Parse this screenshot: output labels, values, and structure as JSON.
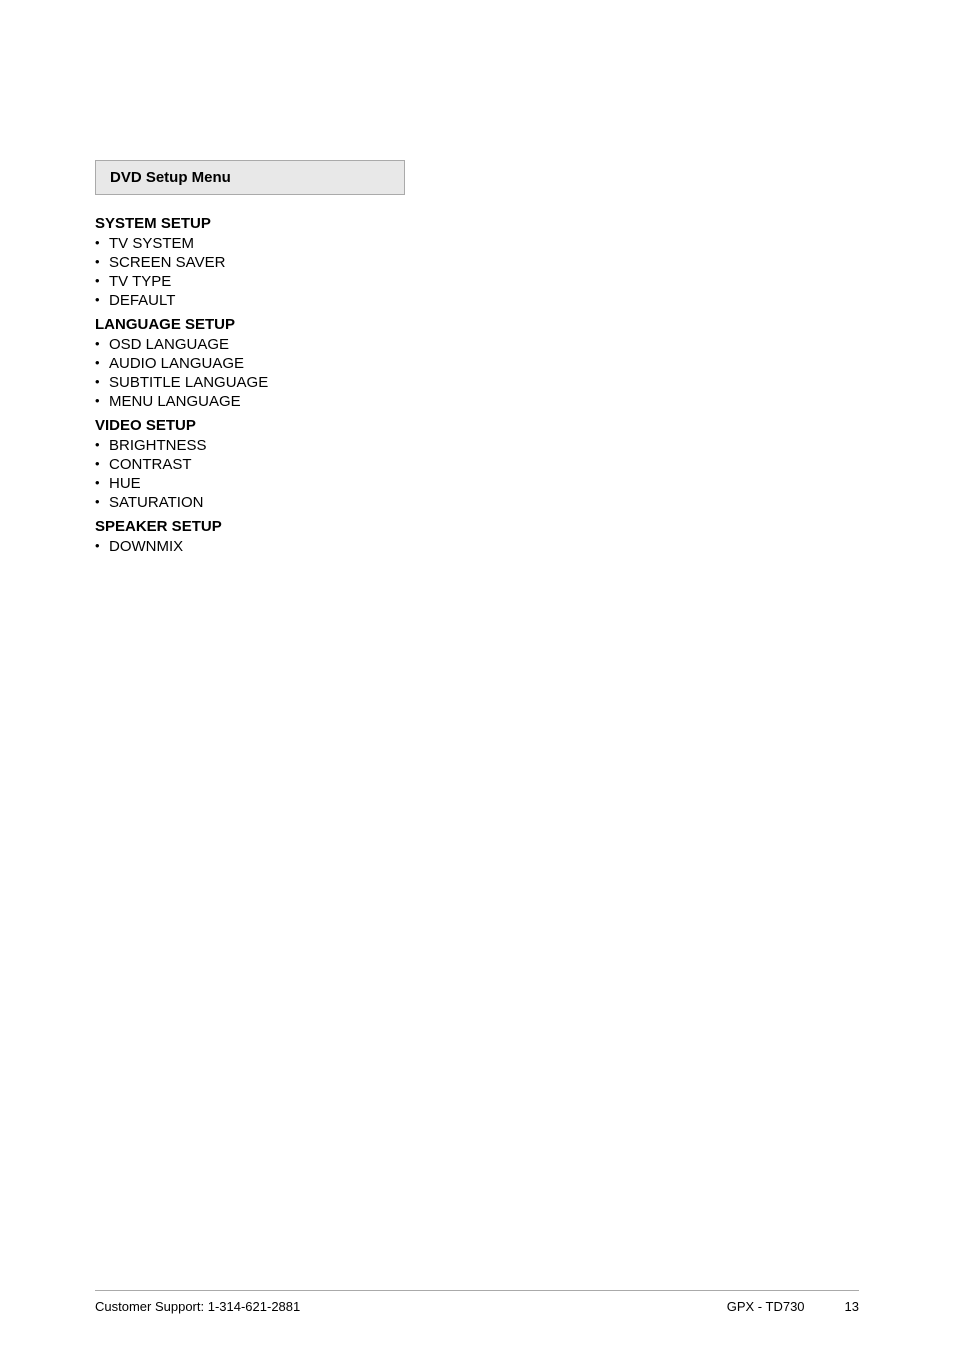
{
  "menuBox": {
    "title": "DVD Setup Menu"
  },
  "sections": [
    {
      "id": "system-setup",
      "title": "SYSTEM SETUP",
      "items": [
        "TV SYSTEM",
        "SCREEN SAVER",
        "TV TYPE",
        "DEFAULT"
      ]
    },
    {
      "id": "language-setup",
      "title": "LANGUAGE SETUP",
      "items": [
        "OSD LANGUAGE",
        "AUDIO LANGUAGE",
        "SUBTITLE LANGUAGE",
        "MENU LANGUAGE"
      ]
    },
    {
      "id": "video-setup",
      "title": "VIDEO SETUP",
      "items": [
        "BRIGHTNESS",
        "CONTRAST",
        "HUE",
        "SATURATION"
      ]
    },
    {
      "id": "speaker-setup",
      "title": "SPEAKER SETUP",
      "items": [
        "DOWNMIX"
      ]
    }
  ],
  "footer": {
    "support": "Customer Support: 1-314-621-2881",
    "model": "GPX - TD730",
    "page": "13"
  }
}
